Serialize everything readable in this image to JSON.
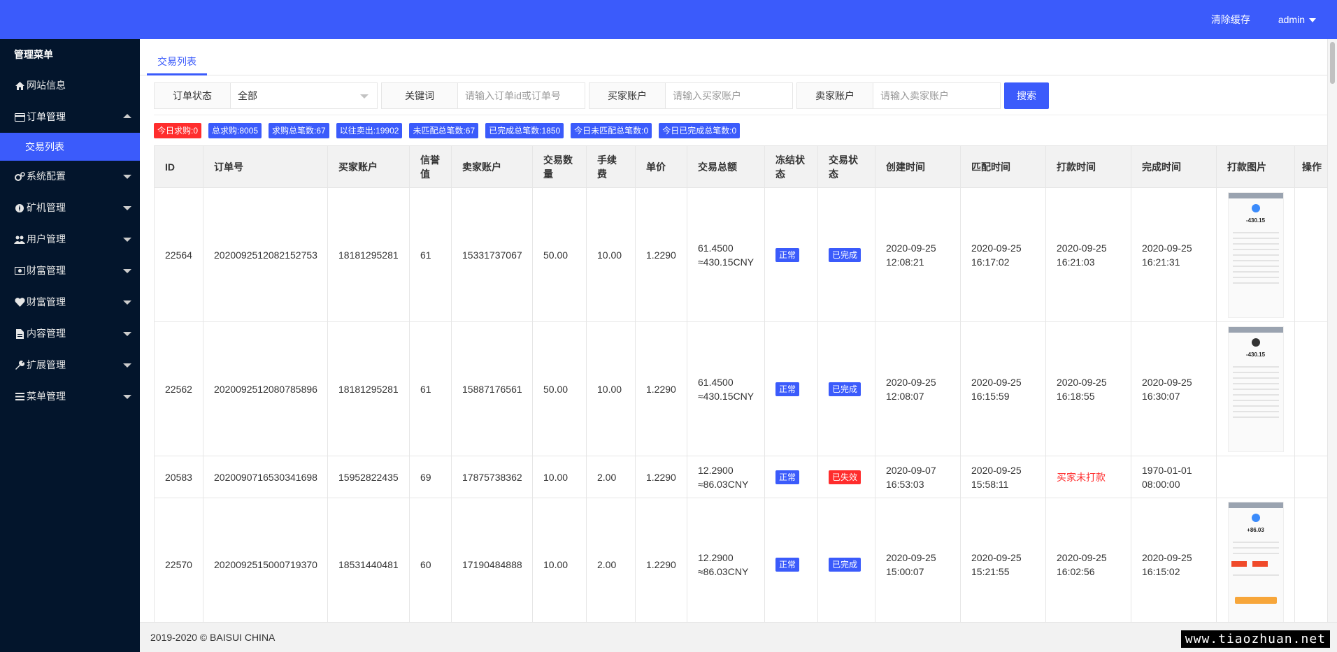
{
  "header": {
    "clear_cache": "清除缓存",
    "user": "admin"
  },
  "sidebar": {
    "title": "管理菜单",
    "items": [
      {
        "label": "网站信息",
        "icon": "home-icon"
      },
      {
        "label": "订单管理",
        "icon": "card-icon",
        "open": true
      },
      {
        "label": "系统配置",
        "icon": "gears-icon"
      },
      {
        "label": "矿机管理",
        "icon": "rebel-icon"
      },
      {
        "label": "用户管理",
        "icon": "users-icon"
      },
      {
        "label": "财富管理",
        "icon": "money-icon"
      },
      {
        "label": "财富管理",
        "icon": "heartbeat-icon"
      },
      {
        "label": "内容管理",
        "icon": "file-icon"
      },
      {
        "label": "扩展管理",
        "icon": "wrench-icon"
      },
      {
        "label": "菜单管理",
        "icon": "bars-icon"
      }
    ],
    "sub_item": "交易列表"
  },
  "tabs": {
    "active": "交易列表"
  },
  "search": {
    "status_label": "订单状态",
    "status_value": "全部",
    "keyword_label": "关键词",
    "keyword_placeholder": "请输入订单id或订单号",
    "buyer_label": "买家账户",
    "buyer_placeholder": "请输入买家账户",
    "seller_label": "卖家账户",
    "seller_placeholder": "请输入卖家账户",
    "button": "搜索"
  },
  "stats": [
    {
      "text": "今日求购:0",
      "color": "red"
    },
    {
      "text": "总求购:8005",
      "color": "blue"
    },
    {
      "text": "求购总笔数:67",
      "color": "blue"
    },
    {
      "text": "以往卖出:19902",
      "color": "blue"
    },
    {
      "text": "未匹配总笔数:67",
      "color": "blue"
    },
    {
      "text": "已完成总笔数:1850",
      "color": "blue"
    },
    {
      "text": "今日未匹配总笔数:0",
      "color": "blue"
    },
    {
      "text": "今日已完成总笔数:0",
      "color": "blue"
    }
  ],
  "table": {
    "columns": [
      "ID",
      "订单号",
      "买家账户",
      "信誉值",
      "卖家账户",
      "交易数量",
      "手续费",
      "单价",
      "交易总额",
      "冻结状态",
      "交易状态",
      "创建时间",
      "匹配时间",
      "打款时间",
      "完成时间",
      "打款图片",
      "操作"
    ],
    "rows": [
      {
        "id": "22564",
        "order": "2020092512082152753",
        "buyer": "18181295281",
        "credit": "61",
        "seller": "15331737067",
        "qty": "50.00",
        "fee": "10.00",
        "price": "1.2290",
        "total1": "61.4500",
        "total2": "≈430.15CNY",
        "freeze": "正常",
        "status": "已完成",
        "status_color": "blue",
        "created1": "2020-09-25",
        "created2": "12:08:21",
        "matched1": "2020-09-25",
        "matched2": "16:17:02",
        "paid1": "2020-09-25",
        "paid2": "16:21:03",
        "done1": "2020-09-25",
        "done2": "16:21:31",
        "img_amount": "-430.15"
      },
      {
        "id": "22562",
        "order": "2020092512080785896",
        "buyer": "18181295281",
        "credit": "61",
        "seller": "15887176561",
        "qty": "50.00",
        "fee": "10.00",
        "price": "1.2290",
        "total1": "61.4500",
        "total2": "≈430.15CNY",
        "freeze": "正常",
        "status": "已完成",
        "status_color": "blue",
        "created1": "2020-09-25",
        "created2": "12:08:07",
        "matched1": "2020-09-25",
        "matched2": "16:15:59",
        "paid1": "2020-09-25",
        "paid2": "16:18:55",
        "done1": "2020-09-25",
        "done2": "16:30:07",
        "img_amount": "-430.15"
      },
      {
        "id": "20583",
        "order": "2020090716530341698",
        "buyer": "15952822435",
        "credit": "69",
        "seller": "17875738362",
        "qty": "10.00",
        "fee": "2.00",
        "price": "1.2290",
        "total1": "12.2900",
        "total2": "≈86.03CNY",
        "freeze": "正常",
        "status": "已失效",
        "status_color": "red",
        "created1": "2020-09-07",
        "created2": "16:53:03",
        "matched1": "2020-09-25",
        "matched2": "15:58:11",
        "paid_text": "买家未打款",
        "done1": "1970-01-01",
        "done2": "08:00:00"
      },
      {
        "id": "22570",
        "order": "2020092515000719370",
        "buyer": "18531440481",
        "credit": "60",
        "seller": "17190484888",
        "qty": "10.00",
        "fee": "2.00",
        "price": "1.2290",
        "total1": "12.2900",
        "total2": "≈86.03CNY",
        "freeze": "正常",
        "status": "已完成",
        "status_color": "blue",
        "created1": "2020-09-25",
        "created2": "15:00:07",
        "matched1": "2020-09-25",
        "matched2": "15:21:55",
        "paid1": "2020-09-25",
        "paid2": "16:02:56",
        "done1": "2020-09-25",
        "done2": "16:15:02",
        "img_amount": "+86.03"
      }
    ]
  },
  "footer": "2019-2020 © BAISUI CHINA",
  "watermark": "www.tiaozhuan.net"
}
